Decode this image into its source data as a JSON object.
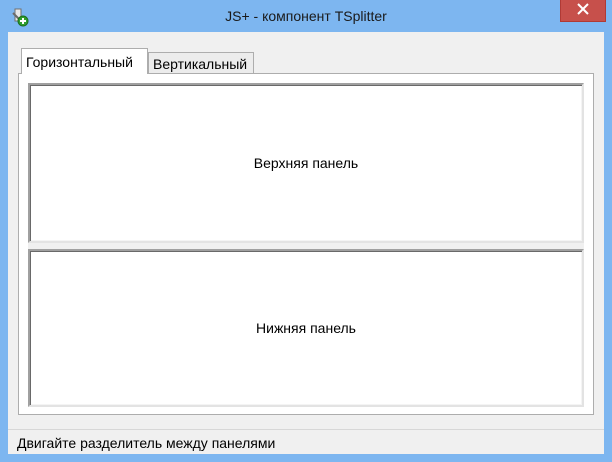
{
  "window": {
    "title": "JS+ - компонент TSplitter",
    "icon": "app-icon",
    "close_icon": "close-icon"
  },
  "tabs": [
    {
      "label": "Горизонтальный",
      "selected": true
    },
    {
      "label": "Вертикальный",
      "selected": false
    }
  ],
  "panels": {
    "top_label": "Верхняя панель",
    "bottom_label": "Нижняя панель"
  },
  "status": {
    "text": "Двигайте разделитель между панелями"
  },
  "colors": {
    "titlebar": "#7db6f0",
    "close_button": "#c7504b",
    "client_background": "#f0f0f0"
  }
}
